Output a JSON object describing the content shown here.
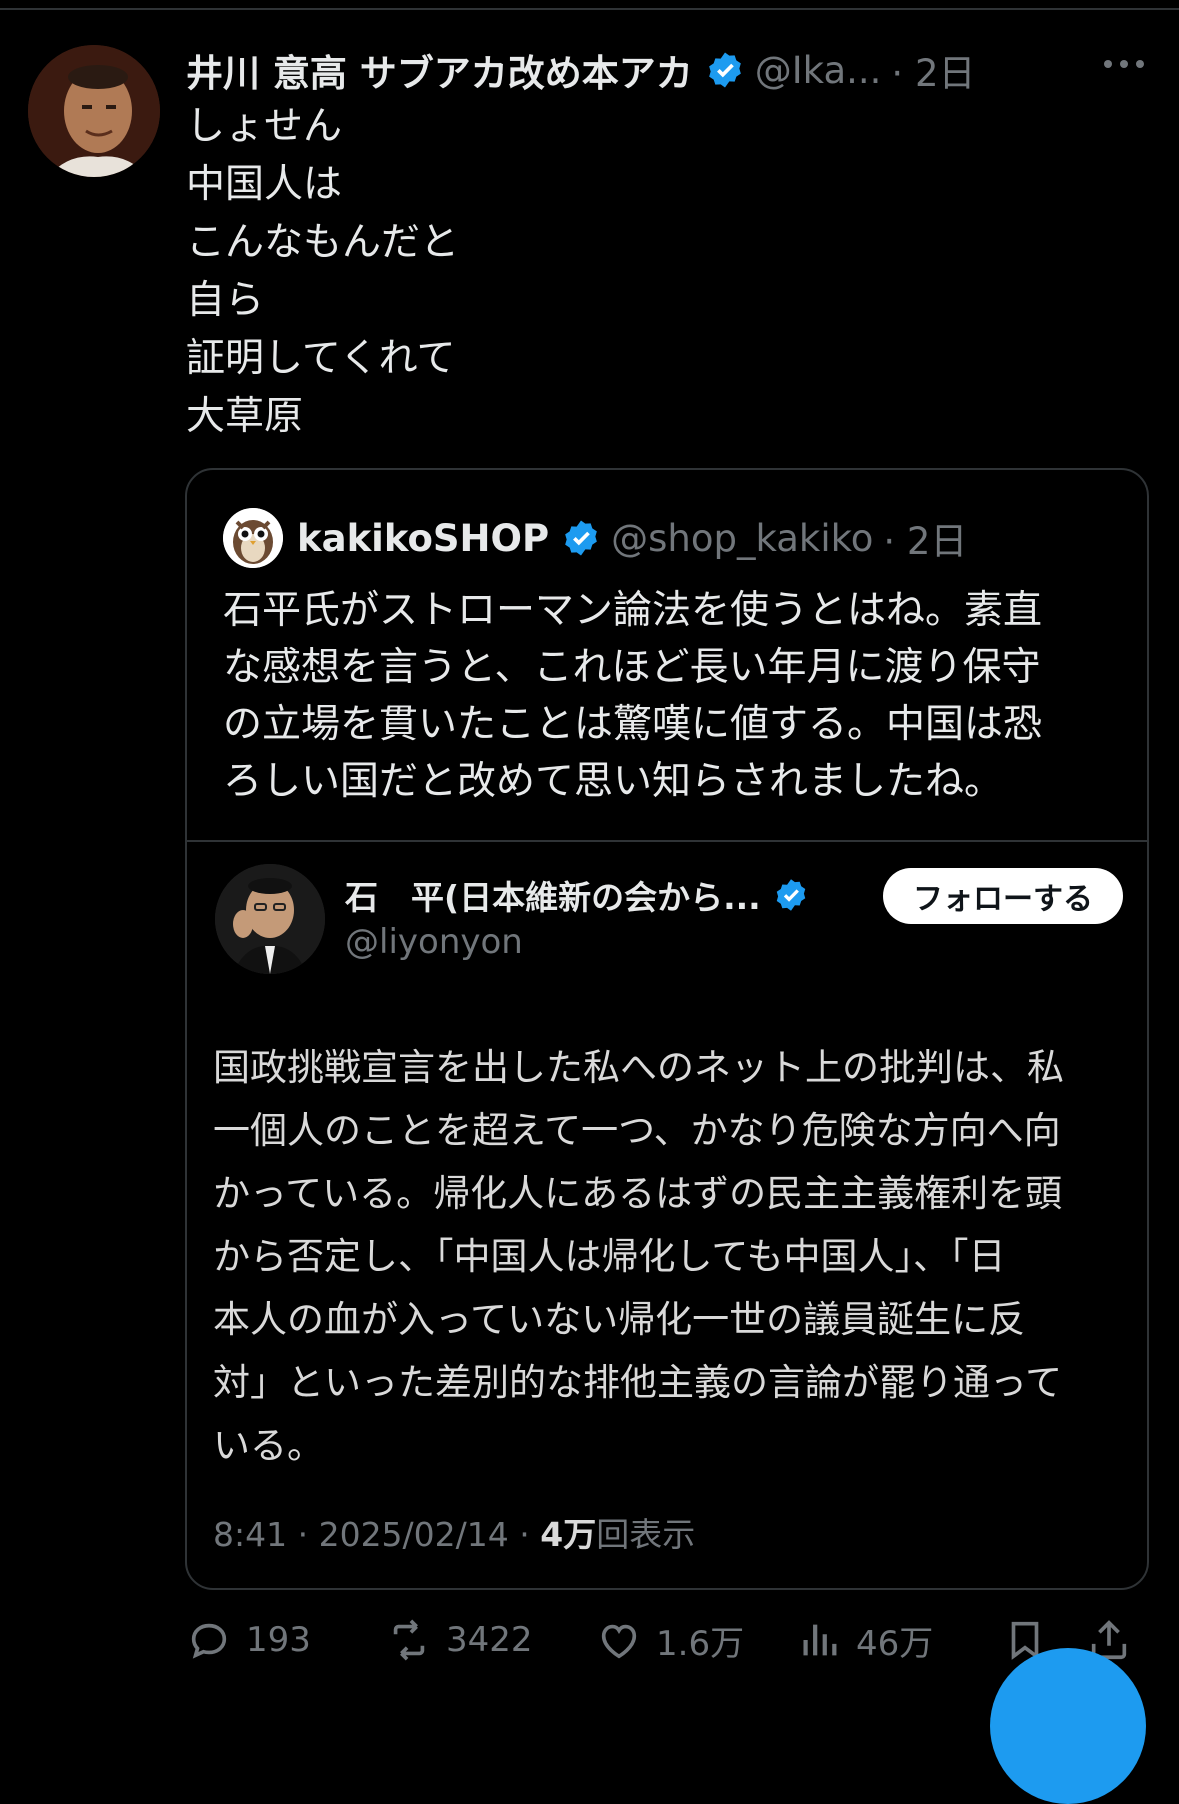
{
  "tweet": {
    "author_name": "井川 意高 サブアカ改め本アカ",
    "handle": "@Ika...",
    "time": "· 2日",
    "lines": [
      "しょせん",
      "中国人は",
      "こんなもんだと",
      "自ら",
      "証明してくれて",
      "大草原"
    ]
  },
  "quote": {
    "author_name": "kakikoSHOP",
    "handle": "@shop_kakiko",
    "time": "· 2日",
    "lines": [
      "石平氏がストローマン論法を使うとはね。素直",
      "な感想を言うと、これほど長い年月に渡り保守",
      "の立場を貫いたことは驚嘆に値する。中国は恐",
      "ろしい国だと改めて思い知らされましたね。"
    ]
  },
  "embed": {
    "author_name": "石　平(日本維新の会から...",
    "handle": "@liyonyon",
    "follow_label": "フォローする",
    "lines": [
      "国政挑戦宣言を出した私へのネット上の批判は、私",
      "一個人のことを超えて一つ、かなり危険な方向へ向",
      "かっている。帰化人にあるはずの民主主義権利を頭",
      "から否定し、「中国人は帰化しても中国人」、「日",
      "本人の血が入っていない帰化一世の議員誕生に反",
      "対」といった差別的な排他主義の言論が罷り通って",
      "いる。"
    ],
    "meta_time": "8:41 · 2025/02/14 · ",
    "meta_views": "4万",
    "meta_views_label": "回表示"
  },
  "actions": {
    "replies": "193",
    "reposts": "3422",
    "likes": "1.6万",
    "views": "46万"
  },
  "icons": {
    "verified": "verified-badge-icon",
    "more": "more-icon",
    "reply": "reply-icon",
    "repost": "repost-icon",
    "like": "like-icon",
    "views": "views-icon",
    "bookmark": "bookmark-icon",
    "share": "share-icon"
  },
  "colors": {
    "background": "#000000",
    "text": "#e7e9ea",
    "secondary": "#71767b",
    "accent": "#1d9bf0",
    "border": "#2f3336"
  }
}
